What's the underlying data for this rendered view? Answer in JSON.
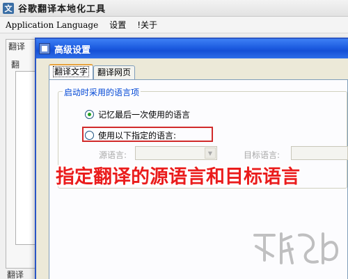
{
  "main_window": {
    "title": "谷歌翻译本地化工具",
    "app_icon": "文",
    "menu": [
      "Application Language",
      "设置",
      "!关于"
    ],
    "bg_labels": [
      "翻译",
      "翻",
      "翻译"
    ]
  },
  "dialog": {
    "title": "高级设置",
    "tabs": [
      "翻译文字",
      "翻译网页"
    ],
    "group_title": "启动时采用的语言项",
    "radio_remember": "记忆最后一次使用的语言",
    "radio_specify": "使用以下指定的语言:",
    "source_label": "源语言:",
    "target_label": "目标语言:"
  },
  "caption": "指定翻译的源语言和目标语言",
  "colors": {
    "accent_title": "#1d5ce0",
    "highlight": "#d12a2a",
    "caption": "#ea1c1c",
    "group_legend": "#0046d5"
  },
  "state": {
    "selected_radio": "remember"
  }
}
